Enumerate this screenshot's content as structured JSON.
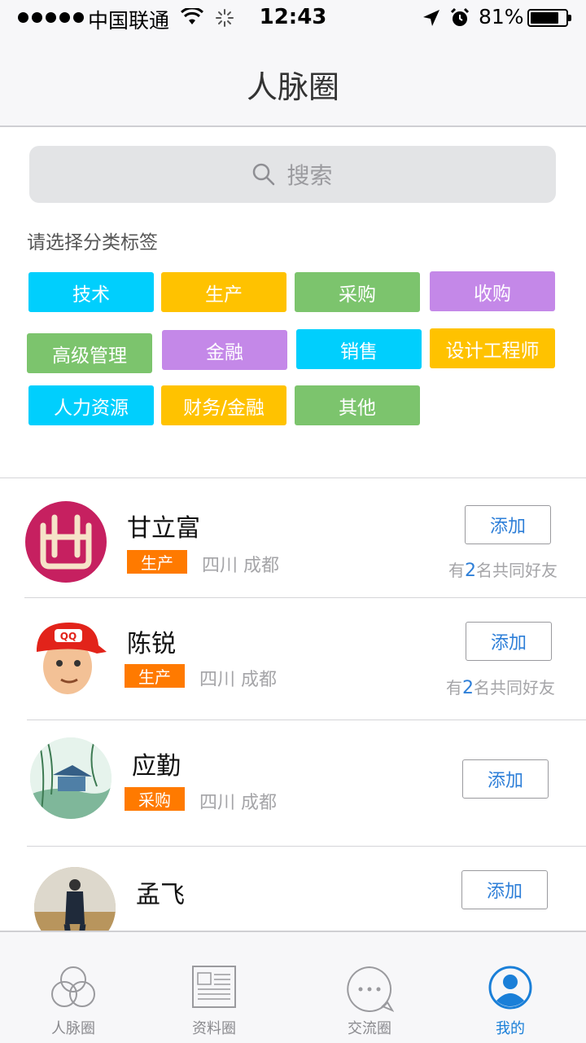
{
  "status_bar": {
    "carrier": "中国联通",
    "time": "12:43",
    "battery_text": "81%",
    "battery_level": 0.81
  },
  "nav": {
    "title": "人脉圈"
  },
  "search": {
    "placeholder": "搜索"
  },
  "tag_hint": "请选择分类标签",
  "tags": [
    {
      "label": "技术",
      "color": "#00cffd"
    },
    {
      "label": "生产",
      "color": "#ffc200"
    },
    {
      "label": "采购",
      "color": "#7cc46d"
    },
    {
      "label": "收购",
      "color": "#c488e8"
    },
    {
      "label": "高级管理",
      "color": "#7cc46d"
    },
    {
      "label": "金融",
      "color": "#c488e8"
    },
    {
      "label": "销售",
      "color": "#00cffd"
    },
    {
      "label": "设计工程师",
      "color": "#ffc200"
    },
    {
      "label": "人力资源",
      "color": "#00cffd"
    },
    {
      "label": "财务/金融",
      "color": "#ffc200"
    },
    {
      "label": "其他",
      "color": "#7cc46d"
    }
  ],
  "contacts": [
    {
      "name": "甘立富",
      "tag": "生产",
      "location": "四川 成都",
      "add_label": "添加",
      "mutual_prefix": "有",
      "mutual_count": "2",
      "mutual_suffix": "名共同好友"
    },
    {
      "name": "陈锐",
      "tag": "生产",
      "location": "四川 成都",
      "add_label": "添加",
      "mutual_prefix": "有",
      "mutual_count": "2",
      "mutual_suffix": "名共同好友"
    },
    {
      "name": "应勤",
      "tag": "采购",
      "location": "四川 成都",
      "add_label": "添加"
    },
    {
      "name": "孟飞",
      "add_label": "添加"
    }
  ],
  "tabbar": {
    "tabs": [
      {
        "label": "人脉圈",
        "icon": "network-circles-icon"
      },
      {
        "label": "资料圈",
        "icon": "document-icon"
      },
      {
        "label": "交流圈",
        "icon": "chat-bubble-icon"
      },
      {
        "label": "我的",
        "icon": "user-profile-icon",
        "active": true
      }
    ]
  },
  "colors": {
    "accent_blue": "#1a7fd8",
    "badge_orange": "#ff7a00"
  }
}
